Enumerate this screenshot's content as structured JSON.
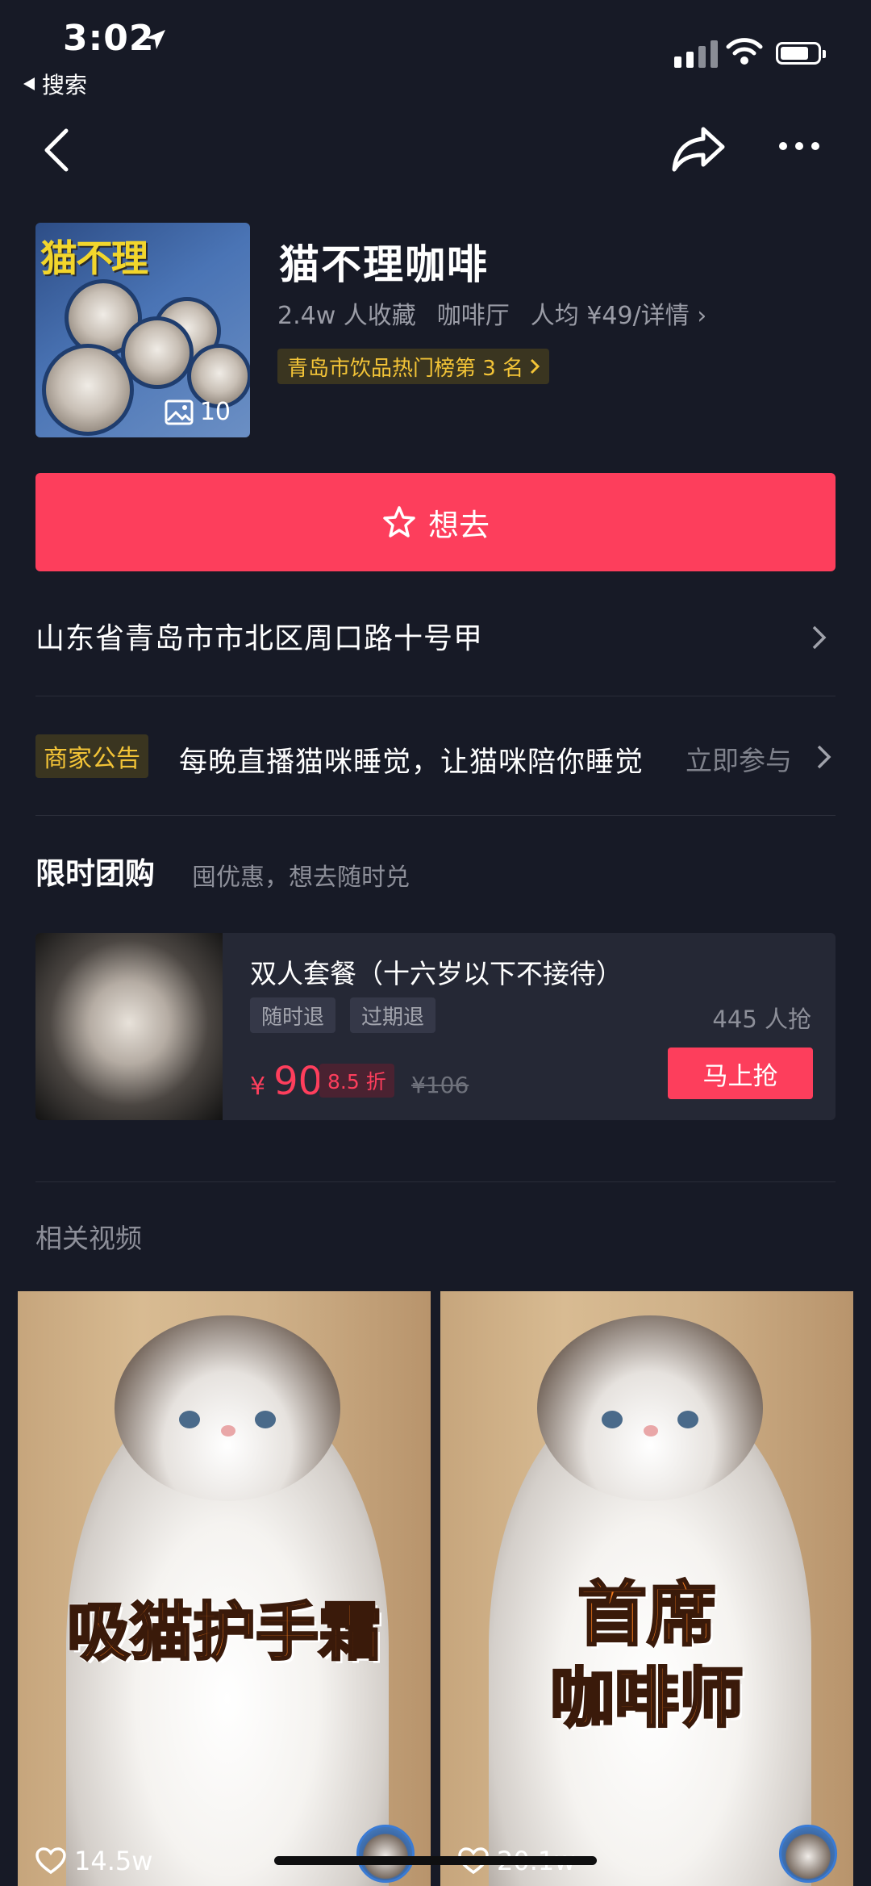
{
  "status_bar": {
    "time": "3:02",
    "back_app": "搜索"
  },
  "shop": {
    "thumb_logo": "猫不理",
    "photo_count": "10",
    "name": "猫不理咖啡",
    "favorites": "2.4w 人收藏",
    "category": "咖啡厅",
    "avg_price": "人均 ¥49/详情",
    "rank": "青岛市饮品热门榜第 3 名"
  },
  "want_button": {
    "label": "想去"
  },
  "address": "山东省青岛市市北区周口路十号甲",
  "notice": {
    "tag": "商家公告",
    "text": "每晚直播猫咪睡觉，让猫咪陪你睡觉",
    "link": "立即参与"
  },
  "group_buy": {
    "title": "限时团购",
    "subtitle": "囤优惠，想去随时兑",
    "deal": {
      "title": "双人套餐（十六岁以下不接待）",
      "tags": [
        "随时退",
        "过期退"
      ],
      "sold": "445 人抢",
      "currency": "¥",
      "price": "90",
      "discount": "8.5 折",
      "original_price": "¥106",
      "button": "马上抢"
    }
  },
  "related": {
    "title": "相关视频",
    "videos": [
      {
        "overlay": "吸猫护手霜",
        "likes": "14.5w"
      },
      {
        "overlay_line1": "首席",
        "overlay_line2": "咖啡师",
        "likes": "20.1w"
      }
    ]
  },
  "colors": {
    "accent": "#fd3e5c",
    "background": "#171a26",
    "gold": "#f3c437"
  }
}
